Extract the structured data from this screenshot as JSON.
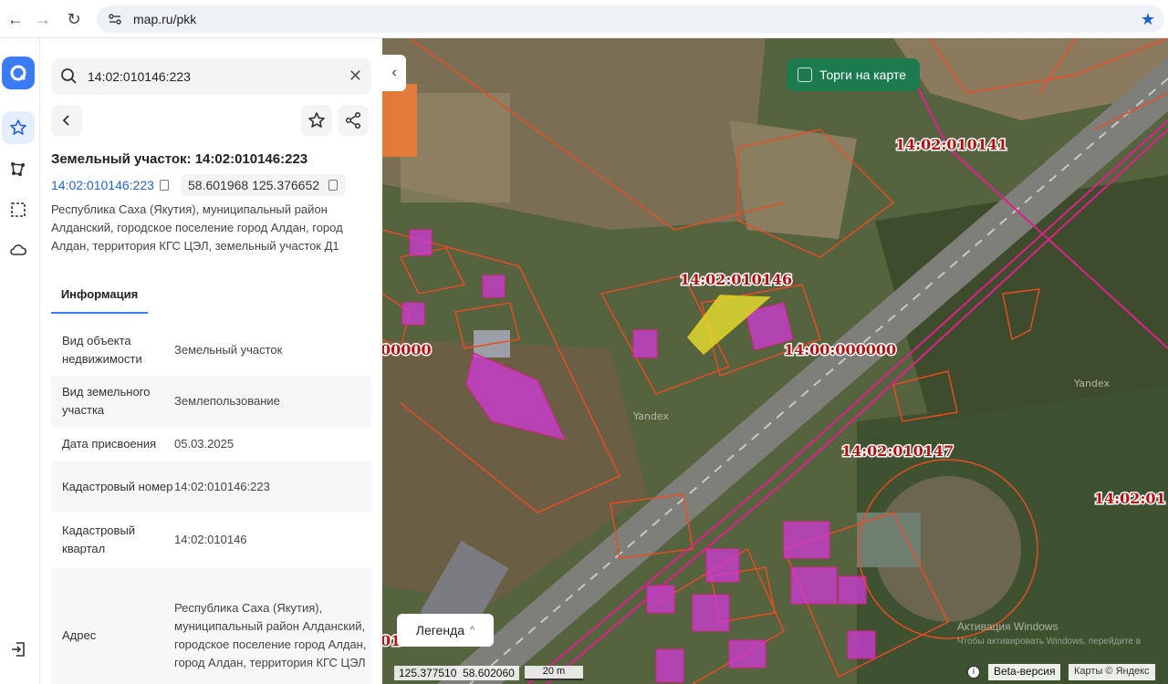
{
  "browser": {
    "url": "map.ru/pkk",
    "back_icon": "←",
    "forward_icon": "→",
    "reload_icon": "↻"
  },
  "search": {
    "value": "14:02:010146:223"
  },
  "parcel": {
    "title": "Земельный участок: 14:02:010146:223",
    "cadastral_link": "14:02:010146:223",
    "coordinates": "58.601968 125.376652",
    "address_short": "Республика Саха (Якутия), муниципальный район Алданский, городское поселение город Алдан, город Алдан, территория КГС ЦЭЛ, земельный участок Д1"
  },
  "tabs": {
    "info": "Информация"
  },
  "info_rows": [
    {
      "key": "Вид объекта недвижимости",
      "value": "Земельный участок"
    },
    {
      "key": "Вид земельного участка",
      "value": "Землепользование"
    },
    {
      "key": "Дата присвоения",
      "value": "05.03.2025"
    },
    {
      "key": "Кадастровый номер",
      "value": "14:02:010146:223"
    },
    {
      "key": "Кадастровый квартал",
      "value": "14:02:010146"
    },
    {
      "key": "Адрес",
      "value": "Республика Саха (Якутия), муниципальный район Алданский, городское поселение город Алдан, город Алдан, территория КГС ЦЭЛ"
    }
  ],
  "map": {
    "collapse_icon": "‹",
    "torgi_label": "Торги на карте",
    "legend_label": "Легенда",
    "legend_chevron": "^",
    "cursor_coords": "125.377510  58.602060",
    "scale_label": "20 m",
    "info_label": "i",
    "beta_label": "Beta-версия",
    "attribution": "Карты © Яндекс",
    "label_010141": "14:02:010141",
    "label_010146": "14:02:010146",
    "label_000000": "14:00:000000",
    "label_000000_left": "00000",
    "label_010147": "14:02:010147",
    "label_right": "14:02:01",
    "label_bottom_left": "01",
    "yandex_wm1": "Yandex",
    "yandex_wm2": "Yandex",
    "win_watermark": "Активация Windows",
    "win_watermark_sub": "Чтобы активировать Windows, перейдите в"
  },
  "colors": {
    "accent": "#3a7bf6",
    "parcel_border": "#f04a24",
    "zone_border": "#e01e8c",
    "building_fill": "#d03ad8",
    "selected_fill": "#e8e030",
    "torgi_bg": "#1b7a4e"
  }
}
